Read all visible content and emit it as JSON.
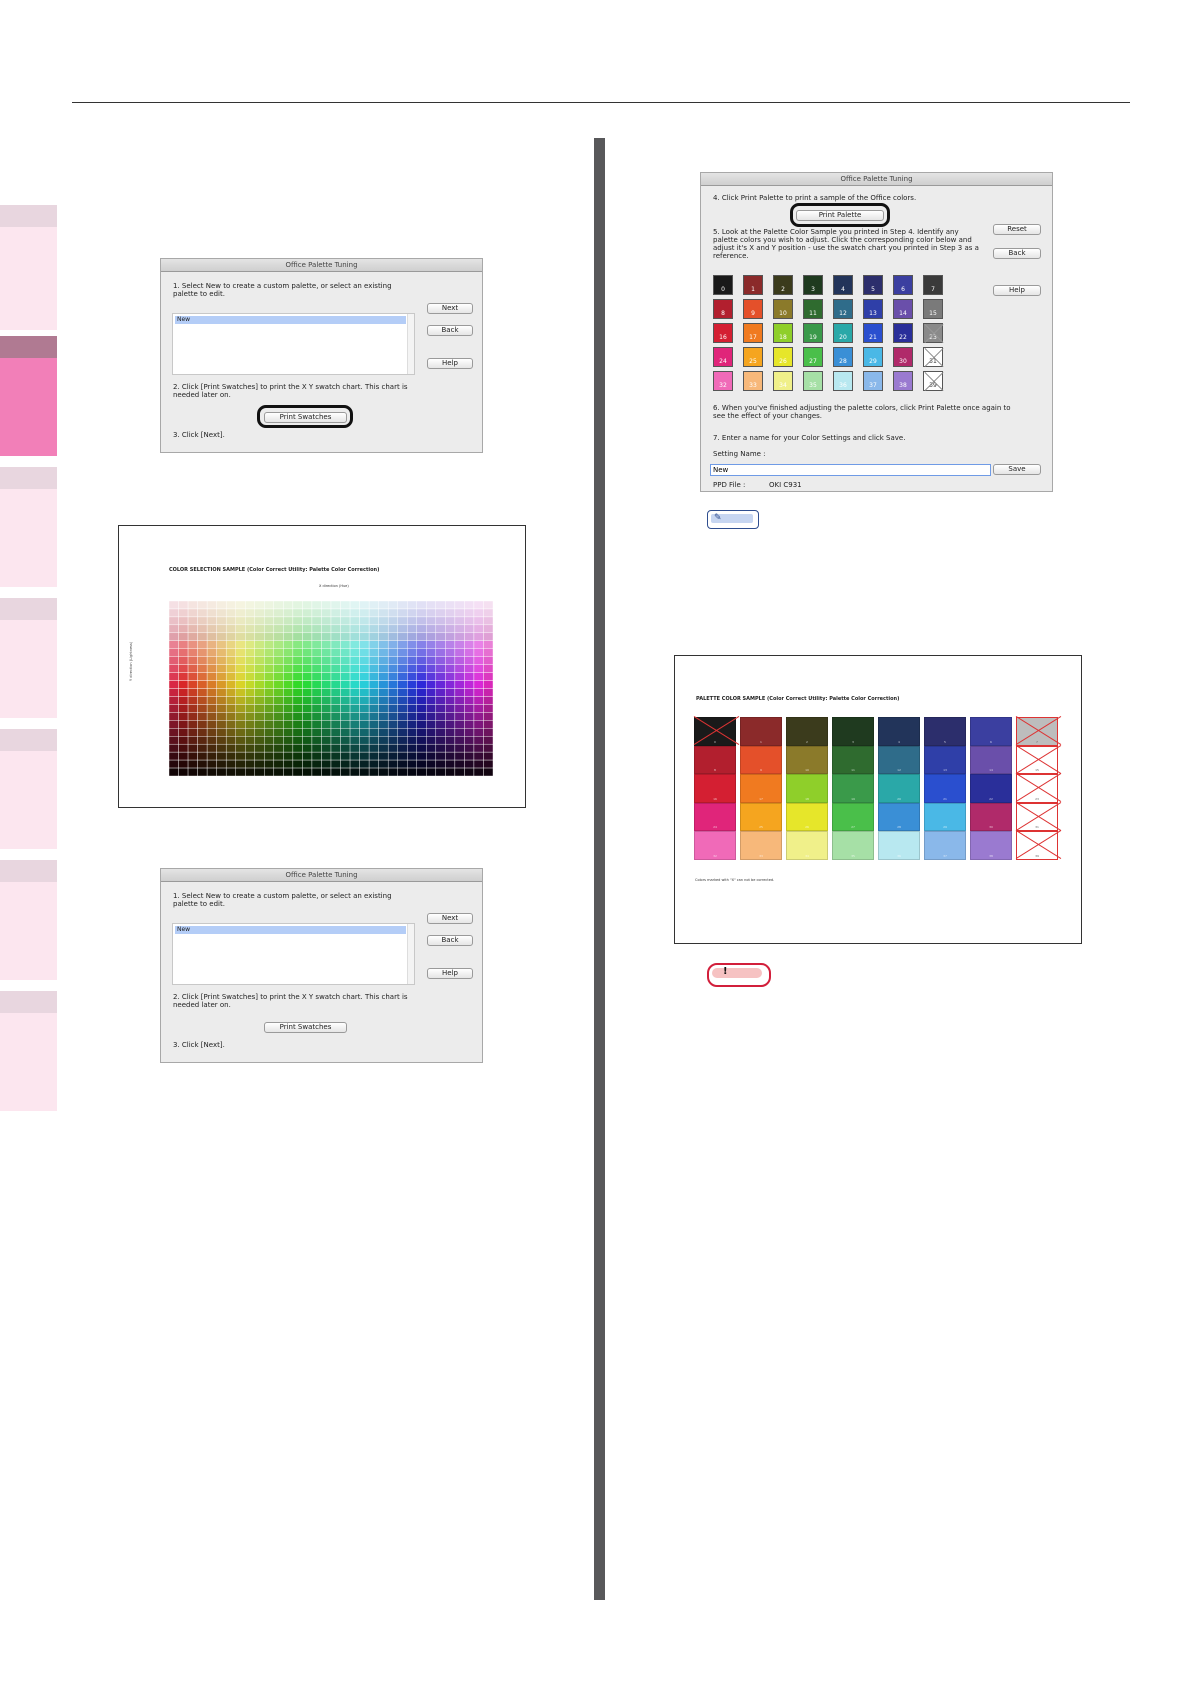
{
  "dialog": {
    "title": "Office Palette Tuning",
    "step1": "1. Select New to create a custom palette, or select an existing palette to edit.",
    "list_selected": "New",
    "next": "Next",
    "back": "Back",
    "help": "Help",
    "step2": "2. Click [Print Swatches] to print the X Y swatch chart. This chart is needed later on.",
    "print_swatches": "Print Swatches",
    "step3": "3. Click [Next]."
  },
  "swatch_chart": {
    "title": "COLOR SELECTION SAMPLE (Color Correct Utility: Palette Color Correction)",
    "x_axis": "X direction (Hue)",
    "y_axis": "Y direction (Lightness)"
  },
  "tuning": {
    "title": "Office Palette Tuning",
    "step4": "4. Click Print Palette to print a sample of the Office colors.",
    "print_palette": "Print Palette",
    "step5": "5. Look at the Palette Color Sample you printed in Step 4. Identify any palette colors you wish to adjust. Click the corresponding color below and adjust it's X and Y position - use the swatch chart you printed in Step 3 as a reference.",
    "reset": "Reset",
    "back": "Back",
    "help": "Help",
    "step6": "6. When you've finished adjusting the palette colors, click Print Palette once again to see the effect of your changes.",
    "step7": "7. Enter a name for your Color Settings and click Save.",
    "setting_name_label": "Setting Name :",
    "setting_name_value": "New",
    "save": "Save",
    "ppd_label": "PPD File :",
    "ppd_value": "OKI C931"
  },
  "palette_sample": {
    "title": "PALETTE COLOR SAMPLE (Color Correct Utility: Palette Color Correction)",
    "footnote": "Colors marked with \"X\" can not be corrected."
  },
  "colors": {
    "swatches": [
      "#1a1a1a",
      "#8b2a2a",
      "#3b3b1c",
      "#1f3a1f",
      "#22345a",
      "#2c2e6c",
      "#3b3fa0",
      "#3a3a3a",
      "#b21f2e",
      "#e4502a",
      "#8b7a2a",
      "#2f6b2f",
      "#2f6c8a",
      "#2f3fa8",
      "#6a4faa",
      "#7a7a7a",
      "#d41f32",
      "#f07a20",
      "#8fcf2a",
      "#3a9a4a",
      "#2aa8a8",
      "#2a4fcf",
      "#2a2f9a",
      "#8a8a8a",
      "#e0257a",
      "#f5a51f",
      "#e6e62a",
      "#4abf4a",
      "#3a8fd6",
      "#4ab8e6",
      "#b02a6a",
      "#ffffff",
      "#f06ab8",
      "#f7b87a",
      "#f0f08a",
      "#a6e0a6",
      "#b8e8f0",
      "#8ab8ea",
      "#9a7ad0",
      "#ffffff"
    ],
    "x_marked": [
      31,
      39
    ],
    "grey_marked": [
      23
    ]
  }
}
